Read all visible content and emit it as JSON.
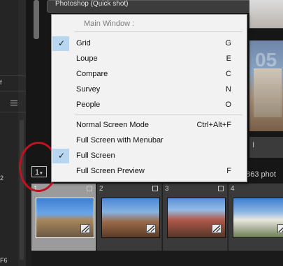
{
  "left_panel": {
    "label_1": "f",
    "label_2": "2",
    "label_3": "F6"
  },
  "main": {
    "top_box_text": "Photoshop (Quick shot)",
    "photo_mid_number": "05",
    "photo_bottom_text": "I",
    "photo_count_text": "f 863 phot",
    "grid_selector": {
      "value": "1",
      "caret": "▾"
    }
  },
  "filmstrip": {
    "cells": [
      {
        "index": "1",
        "selected": true
      },
      {
        "index": "2",
        "selected": false
      },
      {
        "index": "3",
        "selected": false
      },
      {
        "index": "4",
        "selected": false
      }
    ]
  },
  "menu": {
    "header": "Main Window :",
    "check_glyph": "✓",
    "items": [
      {
        "label": "Grid",
        "shortcut": "G",
        "checked": true
      },
      {
        "label": "Loupe",
        "shortcut": "E",
        "checked": false
      },
      {
        "label": "Compare",
        "shortcut": "C",
        "checked": false
      },
      {
        "label": "Survey",
        "shortcut": "N",
        "checked": false
      },
      {
        "label": "People",
        "shortcut": "O",
        "checked": false
      },
      {
        "label": "Normal Screen Mode",
        "shortcut": "Ctrl+Alt+F",
        "checked": false
      },
      {
        "label": "Full Screen with Menubar",
        "shortcut": "",
        "checked": false
      },
      {
        "label": "Full Screen",
        "shortcut": "",
        "checked": true
      },
      {
        "label": "Full Screen Preview",
        "shortcut": "F",
        "checked": false
      }
    ]
  },
  "colors": {
    "highlight": "#c0131f",
    "check_bg": "#b9d6f0",
    "menu_bg": "#f2f2f2"
  }
}
